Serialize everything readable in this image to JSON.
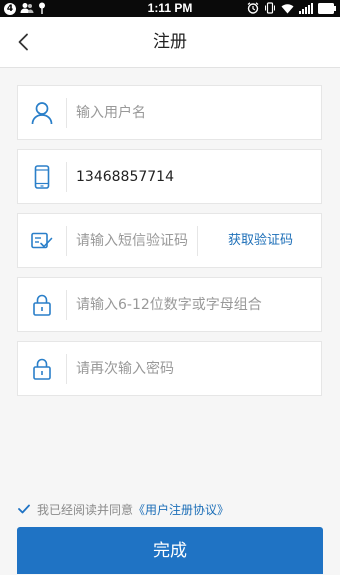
{
  "status_bar": {
    "notification_count": "4",
    "time": "1:11 PM"
  },
  "header": {
    "title": "注册"
  },
  "form": {
    "username": {
      "value": "",
      "placeholder": "输入用户名"
    },
    "phone": {
      "value": "13468857714",
      "placeholder": ""
    },
    "sms_code": {
      "value": "",
      "placeholder": "请输入短信验证码",
      "button_label": "获取验证码"
    },
    "password": {
      "value": "",
      "placeholder": "请输入6-12位数字或字母组合"
    },
    "confirm_password": {
      "value": "",
      "placeholder": "请再次输入密码"
    }
  },
  "agreement": {
    "checked": true,
    "text": "我已经阅读并同意",
    "link_text": "《用户注册协议》"
  },
  "submit": {
    "label": "完成"
  },
  "colors": {
    "accent": "#1f73c4",
    "link": "#1d6fb8",
    "icon": "#2a7fc9"
  }
}
